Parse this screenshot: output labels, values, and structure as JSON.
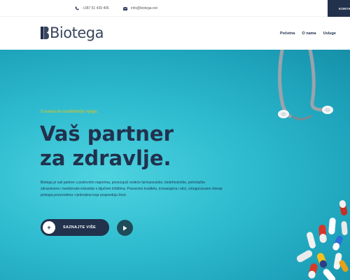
{
  "topbar": {
    "phone": "+387 51 439 406",
    "email": "info@biotega.net",
    "contact_button": "KONTAKT"
  },
  "header": {
    "logo_text": "Biotega",
    "nav": [
      {
        "label": "Početna"
      },
      {
        "label": "O nama"
      },
      {
        "label": "Usluge"
      }
    ]
  },
  "hero": {
    "tagline": "S nama do kvalitetnije njege.",
    "title_line1": "Vaš partner",
    "title_line2": "za zdravlje.",
    "description": "Biotega je vaš partner u poslovnim naporima, povezujući vodeće farmaceutske, biotehnološke, potrošačke zdravstvene i medicinske industrije s ključnim tržištima. Posvećeni kvalitetu, inovacijama i etici, omogućavamo širenje pristupa proizvodima i rješenjima koja unapređuju život.",
    "cta_label": "SAZNAJTE VIŠE",
    "cta_icon": "plus-icon",
    "play_icon": "play-icon"
  },
  "colors": {
    "primary": "#22314c",
    "accent": "#b5c24d",
    "hero_bg": "#2fbcd0"
  }
}
